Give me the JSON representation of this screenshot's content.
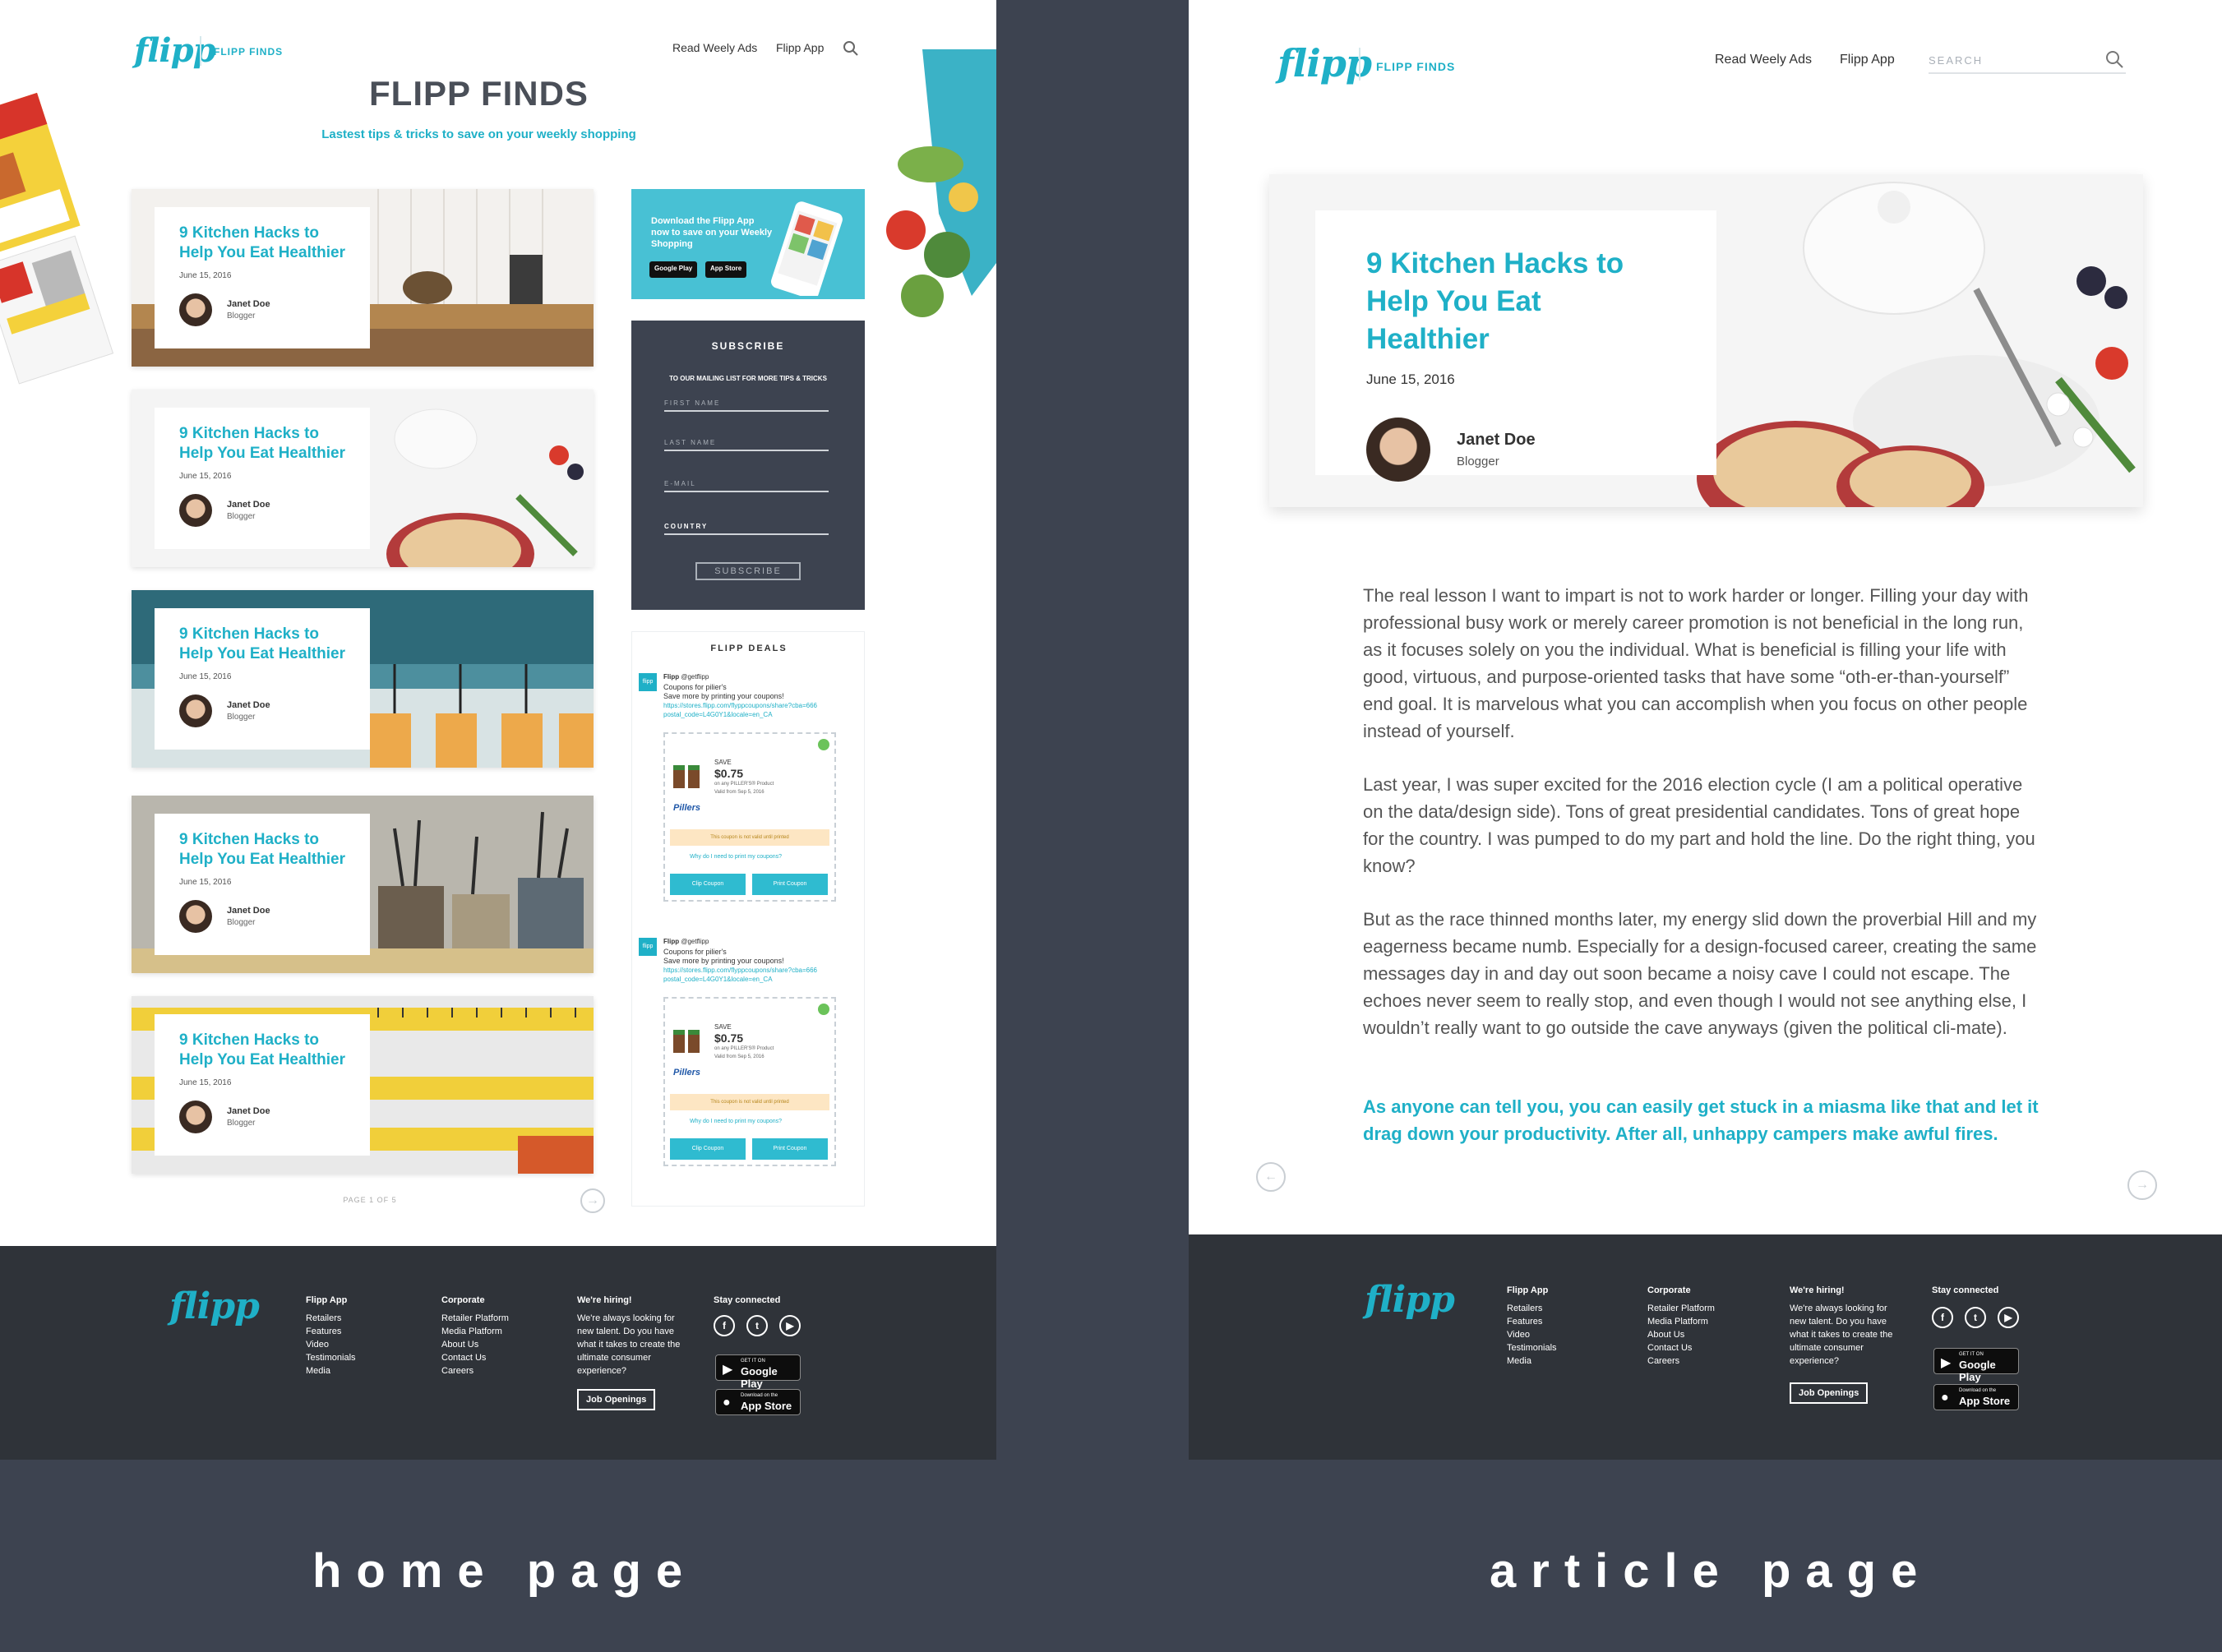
{
  "home": {
    "logo": "flipp",
    "brand": "FLIPP FINDS",
    "nav": [
      "Read Weely Ads",
      "Flipp App"
    ],
    "title": "FLIPP FINDS",
    "subtitle": "Lastest tips & tricks to save on your weekly shopping",
    "cards": [
      {
        "title": "9 Kitchen Hacks to Help You Eat Healthier",
        "date": "June 15, 2016",
        "author": "Janet Doe",
        "role": "Blogger"
      },
      {
        "title": "9 Kitchen Hacks to Help You Eat Healthier",
        "date": "June 15, 2016",
        "author": "Janet Doe",
        "role": "Blogger"
      },
      {
        "title": "9 Kitchen Hacks to Help You Eat Healthier",
        "date": "June 15, 2016",
        "author": "Janet Doe",
        "role": "Blogger"
      },
      {
        "title": "9 Kitchen Hacks to Help You Eat Healthier",
        "date": "June 15, 2016",
        "author": "Janet Doe",
        "role": "Blogger"
      },
      {
        "title": "9 Kitchen Hacks to Help You Eat Healthier",
        "date": "June 15, 2016",
        "author": "Janet Doe",
        "role": "Blogger"
      }
    ],
    "app_promo": {
      "text": "Download the Flipp App now to save on your Weekly Shopping",
      "google": "Google Play",
      "apple": "App Store"
    },
    "subscribe": {
      "title": "SUBSCRIBE",
      "desc": "TO OUR MAILING LIST FOR MORE TIPS & TRICKS",
      "first": "FIRST NAME",
      "last": "LAST NAME",
      "email": "E-MAIL",
      "country": "COUNTRY",
      "button": "SUBSCRIBE"
    },
    "deals": {
      "title": "FLIPP DEALS",
      "items": [
        {
          "logo": "flipp",
          "account": "Flipp",
          "handle": "@getflipp",
          "line1": "Coupons for pilier's",
          "line2": "Save more by printing your coupons!",
          "link": "https://stores.flipp.com/flyppcoupons/share?cba=666 postal_code=L4G0Y1&locale=en_CA",
          "save": "SAVE",
          "amount": "$0.75",
          "product": "on any PILLER'S® Product",
          "valid": "Valid from Sep 5, 2016",
          "brand": "Pillers",
          "warn": "This coupon is not valid until printed",
          "why": "Why do I need to print my coupons?",
          "btn1": "Clip Coupon",
          "btn2": "Print Coupon"
        },
        {
          "logo": "flipp",
          "account": "Flipp",
          "handle": "@getflipp",
          "line1": "Coupons for pilier's",
          "line2": "Save more by printing your coupons!",
          "link": "https://stores.flipp.com/flyppcoupons/share?cba=666 postal_code=L4G0Y1&locale=en_CA",
          "save": "SAVE",
          "amount": "$0.75",
          "product": "on any PILLER'S® Product",
          "valid": "Valid from Sep 5, 2016",
          "brand": "Pillers",
          "warn": "This coupon is not valid until printed",
          "why": "Why do I need to print my coupons?",
          "btn1": "Clip Coupon",
          "btn2": "Print Coupon"
        }
      ]
    },
    "pager": "PAGE 1 OF 5",
    "next_arrow": "→"
  },
  "footer": {
    "logo": "flipp",
    "col1": {
      "heading": "Flipp App",
      "links": [
        "Retailers",
        "Features",
        "Video",
        "Testimonials",
        "Media"
      ]
    },
    "col2": {
      "heading": "Corporate",
      "links": [
        "Retailer Platform",
        "Media Platform",
        "About Us",
        "Contact Us",
        "Careers"
      ]
    },
    "col3": {
      "heading": "We're hiring!",
      "text": "We're always looking for new talent. Do you have what it takes to create the ultimate consumer experience?",
      "button": "Job Openings"
    },
    "col4": {
      "heading": "Stay connected",
      "social": [
        "f",
        "t",
        "▶"
      ]
    },
    "google_small": "GET IT ON",
    "google": "Google Play",
    "apple_small": "Download on the",
    "apple": "App Store"
  },
  "article": {
    "logo": "flipp",
    "brand": "FLIPP FINDS",
    "nav": [
      "Read Weely Ads",
      "Flipp App"
    ],
    "search_placeholder": "SEARCH",
    "hero": {
      "title": "9 Kitchen Hacks to Help You Eat Healthier",
      "date": "June 15, 2016",
      "author": "Janet Doe",
      "role": "Blogger"
    },
    "paragraphs": [
      "The real lesson I want to impart is not to work harder or longer. Filling your day with professional busy work or merely career promotion is not beneficial in the long run, as it focuses solely on you the individual. What is beneficial is filling your life with good, virtuous, and purpose-oriented tasks that have some “oth-er-than-yourself” end goal. It is marvelous what you can accomplish when you focus on other people instead of yourself.",
      "Last year, I was super excited for the 2016 election cycle (I am a political operative on the data/design side). Tons of great presidential candidates. Tons of great hope for the country. I was pumped to do my part and hold the line. Do the right thing, you know?",
      "But as the race thinned months later, my energy slid down the proverbial Hill and my eagerness became numb. Especially for a design-focused career, creating the same messages day in and day out soon became a noisy cave I could not escape. The echoes never seem to really stop, and even though I would not see anything else, I wouldn’t really want to go outside the cave anyways (given the political cli-mate)."
    ],
    "quote": "As anyone can tell you, you can easily get stuck in a miasma like that and let it drag down your productivity. After all, unhappy campers make awful fires.",
    "prev_arrow": "←",
    "next_arrow": "→"
  },
  "captions": {
    "home": "home page",
    "article": "article page"
  },
  "colors": {
    "accent": "#1fb0c7",
    "dark": "#3d4350",
    "footer": "#2f3339"
  }
}
